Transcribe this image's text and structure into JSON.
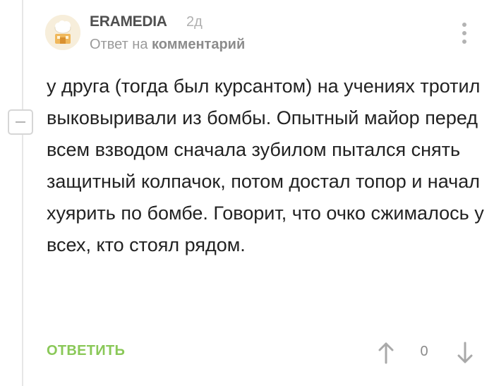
{
  "comment": {
    "author": "ERAMEDIA",
    "age": "2д",
    "reply_prefix": "Ответ на",
    "reply_link": "комментарий",
    "body": "у друга (тогда был курсантом) на учениях тротил выковыривали из бомбы. Опытный майор перед всем взводом сначала зубилом пытался снять защитный колпачок, потом достал топор и начал хуярить по бомбе. Говорит, что очко сжималось у всех, кто стоял рядом.",
    "reply_button": "ОТВЕТИТЬ",
    "rating": "0"
  },
  "icons": {
    "collapse": "minus-icon",
    "more": "more-vertical-icon",
    "upvote": "arrow-up-icon",
    "downvote": "arrow-down-icon"
  },
  "colors": {
    "accent_green": "#8ac858",
    "muted_text": "#9a9a9a",
    "icon_gray": "#b3b3b3"
  }
}
